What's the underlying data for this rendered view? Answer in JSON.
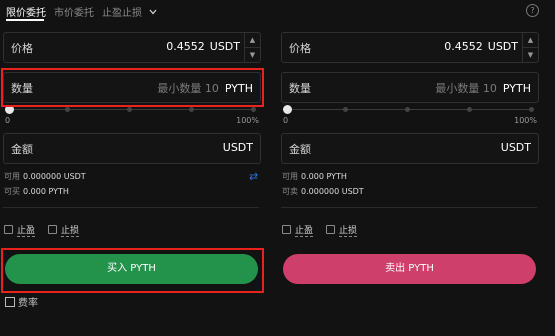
{
  "tabs": {
    "limit": "限价委托",
    "market": "市价委托",
    "tpsl": "止盈止损"
  },
  "icons": {
    "dropdown": "chevron-down-icon",
    "help": "help-circle-icon",
    "transfer": "transfer-icon",
    "fee": "fee-icon"
  },
  "buy": {
    "price_label": "价格",
    "price_value": "0.4552",
    "price_unit": "USDT",
    "qty_label": "数量",
    "qty_placeholder": "最小数量 10",
    "qty_unit": "PYTH",
    "slider_min": "0",
    "slider_max": "100%",
    "amount_label": "金额",
    "amount_unit": "USDT",
    "available_label": "可用",
    "available_value": "0.000000 USDT",
    "can_buy_label": "可买",
    "can_buy_value": "0.000 PYTH",
    "take_profit": "止盈",
    "stop_loss": "止损",
    "action": "买入 PYTH",
    "fee_label": "费率"
  },
  "sell": {
    "price_label": "价格",
    "price_value": "0.4552",
    "price_unit": "USDT",
    "qty_label": "数量",
    "qty_placeholder": "最小数量 10",
    "qty_unit": "PYTH",
    "slider_min": "0",
    "slider_max": "100%",
    "amount_label": "金额",
    "amount_unit": "USDT",
    "available_label": "可用",
    "available_value": "0.000 PYTH",
    "can_sell_label": "可卖",
    "can_sell_value": "0.000000 USDT",
    "take_profit": "止盈",
    "stop_loss": "止损",
    "action": "卖出 PYTH"
  },
  "colors": {
    "buy": "#23924b",
    "sell": "#cf3f6b",
    "highlight": "#e8231b",
    "accent": "#2e6fd8"
  }
}
